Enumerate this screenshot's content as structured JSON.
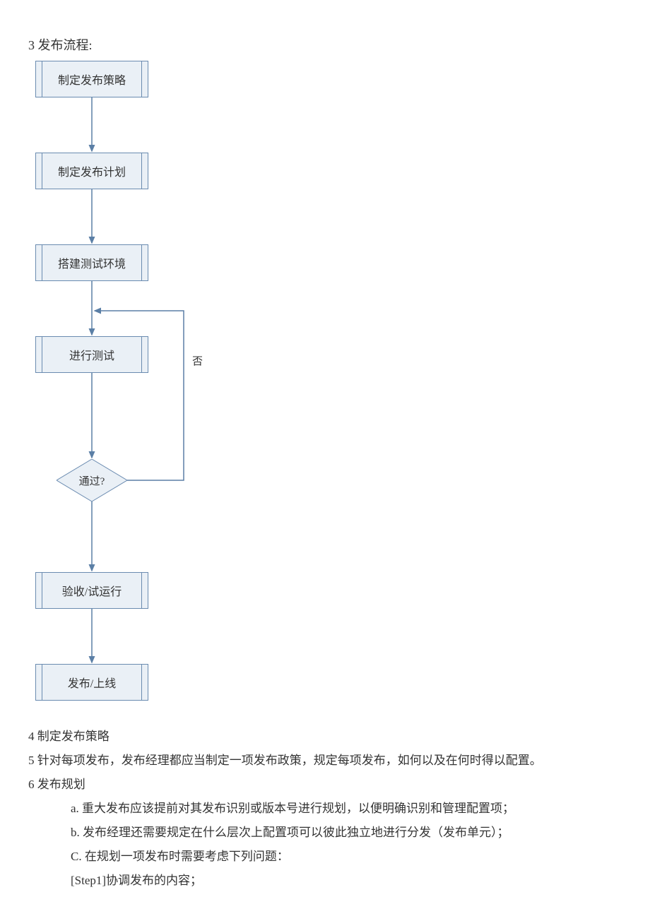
{
  "heading_flow": "3 发布流程:",
  "flow": {
    "step1": "制定发布策略",
    "step2": "制定发布计划",
    "step3": "搭建测试环境",
    "step4": "进行测试",
    "decision": "通过?",
    "no_label": "否",
    "step5": "验收/试运行",
    "step6": "发布/上线"
  },
  "p4": "4 制定发布策略",
  "p5": "5   针对每项发布，发布经理都应当制定一项发布政策，规定每项发布，如何以及在何时得以配置。",
  "p6": "6   发布规划",
  "p6a": "a. 重大发布应该提前对其发布识别或版本号进行规划，以便明确识别和管理配置项；",
  "p6b": "b. 发布经理还需要规定在什么层次上配置项可以彼此独立地进行分发（发布单元）；",
  "p6c": "C. 在规划一项发布时需要考虑下列问题：",
  "p6step1": "[Step1]协调发布的内容；",
  "arrow_color": "#5b7fa6",
  "box_fill": "#eaf0f6",
  "box_stroke": "#6a8bb0"
}
